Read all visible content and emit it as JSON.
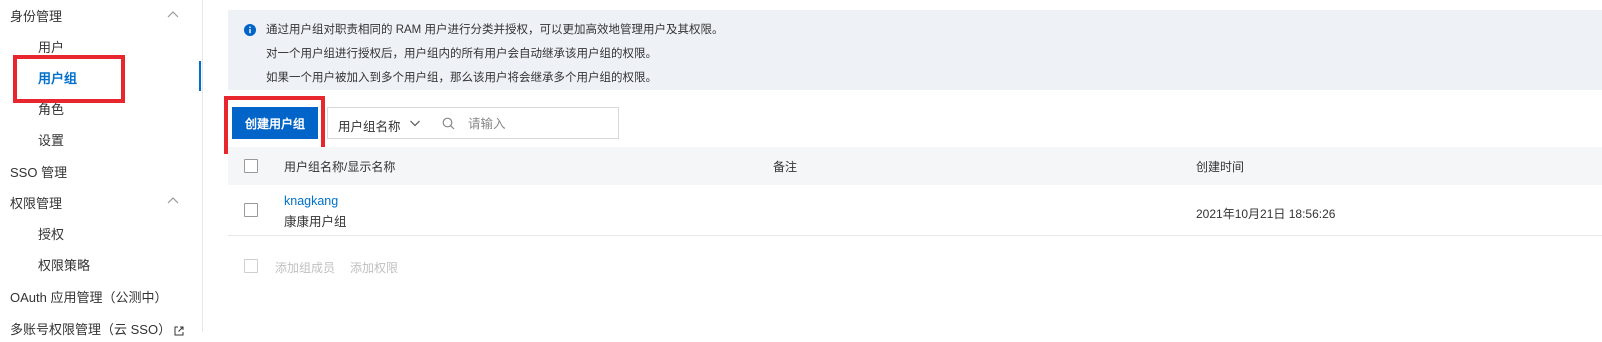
{
  "sidebar": {
    "identity_group": "身份管理",
    "identity_items": [
      "用户",
      "用户组",
      "角色",
      "设置"
    ],
    "active_item": "用户组",
    "sso": "SSO 管理",
    "permission_group": "权限管理",
    "permission_items": [
      "授权",
      "权限策略"
    ],
    "oauth": "OAuth 应用管理（公测中）",
    "multi_account": "多账号权限管理（云 SSO）"
  },
  "notice": {
    "lines": [
      "通过用户组对职责相同的 RAM 用户进行分类并授权，可以更加高效地管理用户及其权限。",
      "对一个用户组进行授权后，用户组内的所有用户会自动继承该用户组的权限。",
      "如果一个用户被加入到多个用户组，那么该用户将会继承多个用户组的权限。"
    ]
  },
  "toolbar": {
    "create_label": "创建用户组",
    "filter_selected": "用户组名称",
    "search_placeholder": "请输入"
  },
  "table": {
    "columns": [
      "用户组名称/显示名称",
      "备注",
      "创建时间"
    ],
    "rows": [
      {
        "name": "knagkang",
        "display_name": "康康用户组",
        "remark": "",
        "created": "2021年10月21日 18:56:26"
      }
    ]
  },
  "footer_actions": [
    "添加组成员",
    "添加权限"
  ],
  "colors": {
    "accent": "#0064c8",
    "highlight_box": "#e8262d",
    "notice_bg": "#eef2f7"
  }
}
